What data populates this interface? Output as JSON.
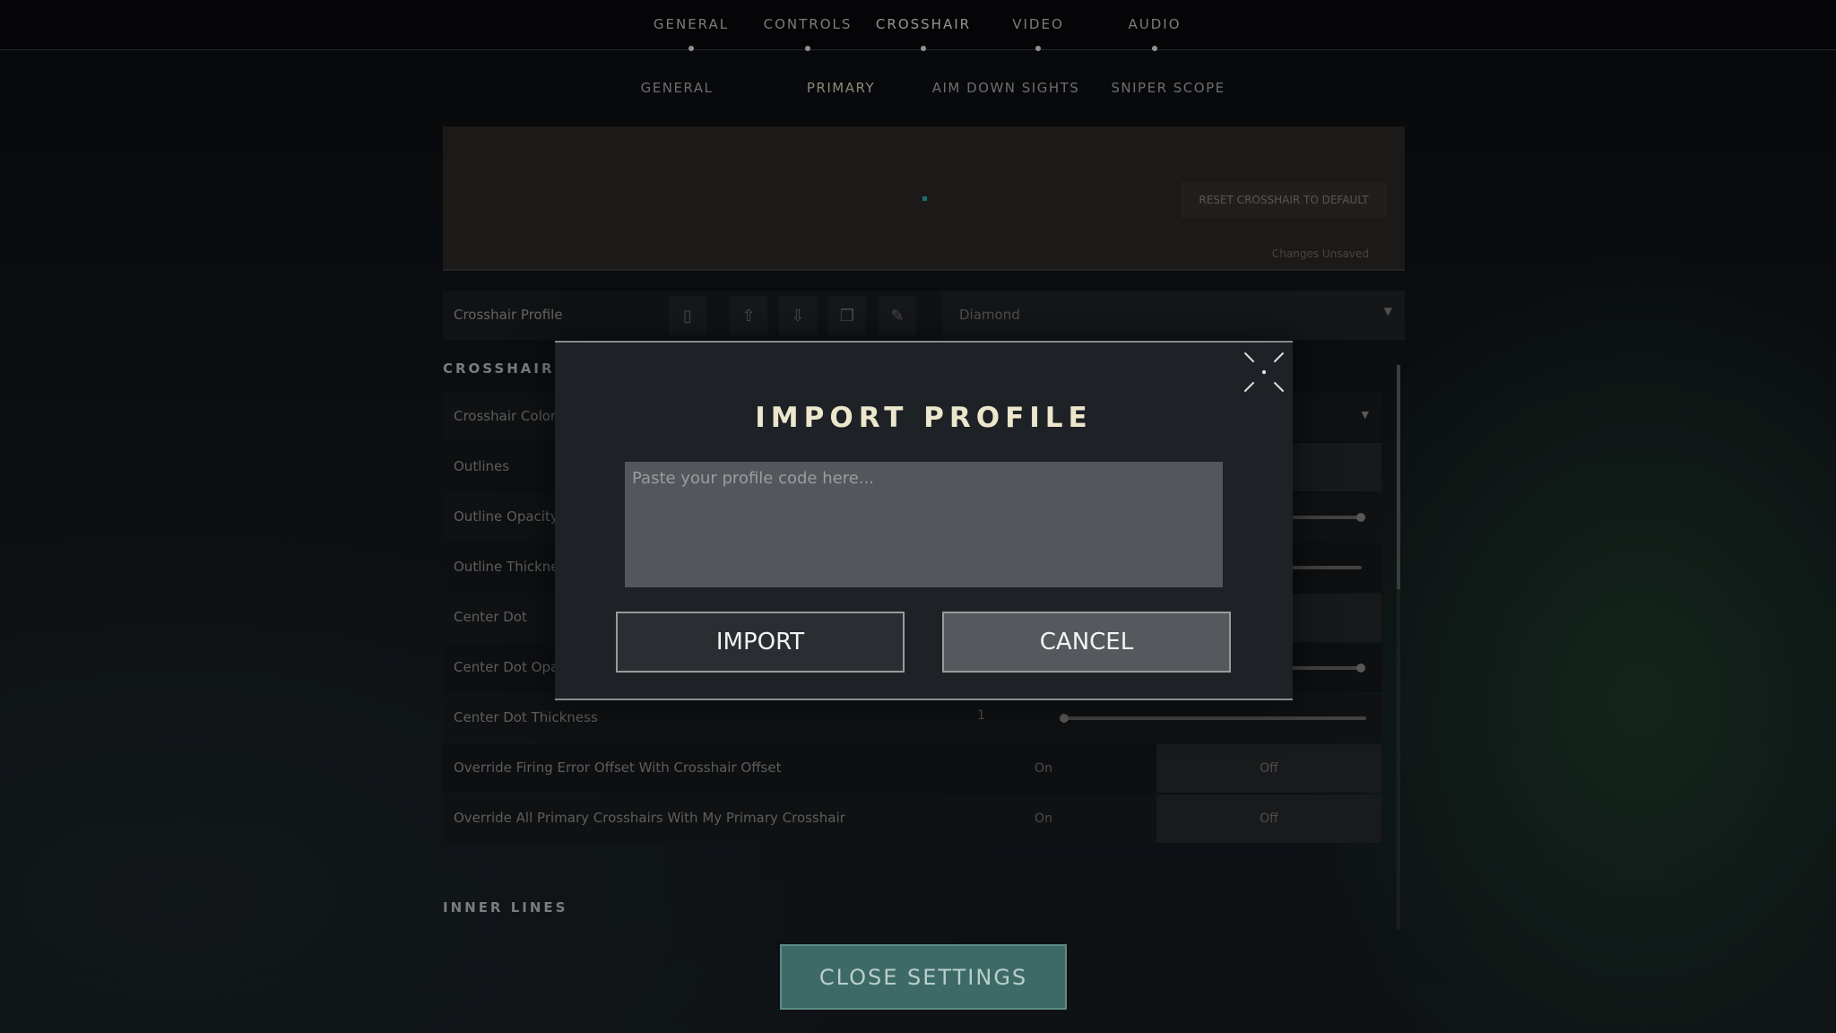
{
  "top_nav": [
    "GENERAL",
    "CONTROLS",
    "CROSSHAIR",
    "VIDEO",
    "AUDIO"
  ],
  "sub_tabs": [
    "GENERAL",
    "PRIMARY",
    "AIM DOWN SIGHTS",
    "SNIPER SCOPE"
  ],
  "active_sub_tab": "PRIMARY",
  "preview": {
    "reset_label": "RESET CROSSHAIR TO DEFAULT",
    "unsaved_label": "Changes Unsaved"
  },
  "profile": {
    "label": "Crosshair Profile",
    "selected": "Diamond",
    "icons": [
      "trash-icon",
      "upload-icon",
      "download-icon",
      "copy-icon",
      "rename-icon"
    ]
  },
  "section_crosshair": "CROSSHAIR",
  "rows": [
    {
      "label": "Crosshair Color"
    },
    {
      "label": "Outlines"
    },
    {
      "label": "Outline Opacity"
    },
    {
      "label": "Outline Thickness"
    },
    {
      "label": "Center Dot"
    },
    {
      "label": "Center Dot Opacity"
    },
    {
      "label": "Center Dot Thickness",
      "value": "1"
    },
    {
      "label": "Override Firing Error Offset With Crosshair Offset",
      "on": "On",
      "off": "Off"
    },
    {
      "label": "Override All Primary Crosshairs With My Primary Crosshair",
      "on": "On",
      "off": "Off"
    }
  ],
  "section_inner": "INNER LINES",
  "modal": {
    "title": "IMPORT PROFILE",
    "placeholder": "Paste your profile code here...",
    "import_label": "IMPORT",
    "cancel_label": "CANCEL"
  },
  "close_settings": "CLOSE SETTINGS",
  "colors": {
    "accent": "#3d6a66",
    "title": "#ece6cc"
  }
}
